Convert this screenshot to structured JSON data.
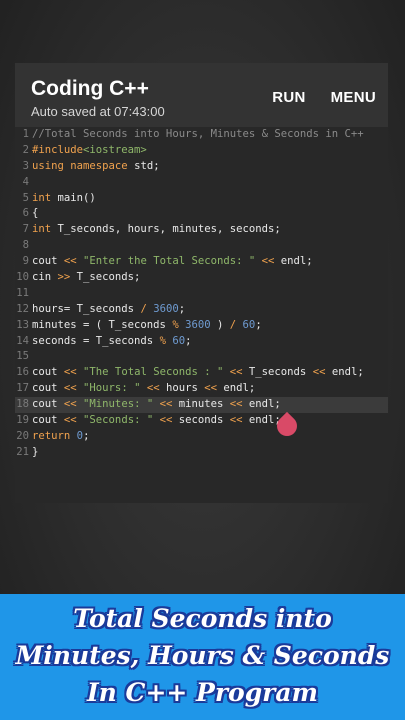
{
  "app": {
    "title": "Coding C++",
    "subtitle": "Auto saved at 07:43:00",
    "run_label": "RUN",
    "menu_label": "MENU"
  },
  "code_lines": [
    "//Total Seconds into Hours, Minutes & Seconds in C++",
    "#include<iostream>",
    "using namespace std;",
    "",
    "int main()",
    "{",
    "int T_seconds, hours, minutes, seconds;",
    "",
    "cout << \"Enter the Total Seconds: \" << endl;",
    "cin >> T_seconds;",
    "",
    "hours= T_seconds / 3600;",
    "minutes = ( T_seconds % 3600 ) / 60;",
    "seconds = T_seconds % 60;",
    "",
    "cout << \"The Total Seconds : \" << T_seconds << endl;",
    "cout << \"Hours: \" << hours << endl;",
    "cout << \"Minutes: \" << minutes << endl;",
    "cout << \"Seconds: \" << seconds << endl;",
    "return 0;",
    "}"
  ],
  "active_line": 18,
  "banner": {
    "line1": "Total Seconds into",
    "line2": "Minutes, Hours & Seconds",
    "line3": "In C++ Program"
  },
  "colors": {
    "banner": "#1f96e8",
    "keyword": "#f0a24e",
    "string": "#8fb76a",
    "number": "#6f9bd1",
    "comment": "#8a8a8a"
  }
}
